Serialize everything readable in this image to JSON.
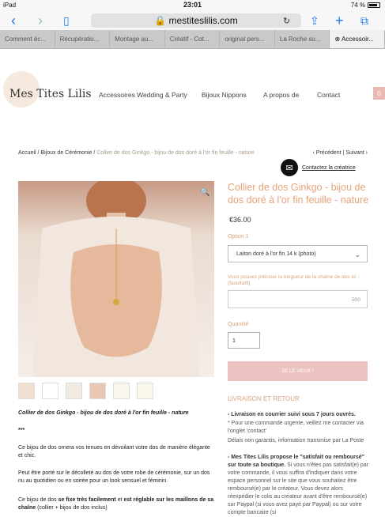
{
  "statusbar": {
    "device": "iPad",
    "time": "23:01",
    "battery": "74 %"
  },
  "browser": {
    "url": "mestiteslilis.com",
    "tabs": [
      "Comment éc...",
      "Récupératio...",
      "Montage au...",
      "Créatif - Cot...",
      "original pers...",
      "La Roche su...",
      "Accessoir..."
    ]
  },
  "site": {
    "logo": "Mes Tites Lilis",
    "nav": [
      "Accessoires Wedding & Party",
      "Bijoux Nippons",
      "A propos de",
      "Contact"
    ],
    "cart_count": "0"
  },
  "breadcrumb": {
    "home": "Accueil",
    "category": "Bijoux de Cérémonie",
    "current": "Collier de dos Ginkgo - bijou de dos doré à l'or fin feuille - nature",
    "prev": "Précédent",
    "next": "Suivant"
  },
  "contact_label": "Contactez la créatrice",
  "product": {
    "title": "Collier de dos Ginkgo - bijou de dos doré à l'or fin feuille - nature",
    "price": "€36.00",
    "option_label": "Option 1",
    "option_value": "Laiton doré à l'or fin 14 k (photo)",
    "custom_label": "Vous pouvez préciser la longueur de la chaîne de dos ici : (facultatif)",
    "custom_counter": "500",
    "qty_label": "Quantité",
    "qty_value": "1",
    "buy_label": "JE LE VEUX !"
  },
  "description": {
    "title": "Collier de dos Ginkgo - bijou de dos doré à l'or fin feuille - nature",
    "stars": "***",
    "p1": "Ce bijou de dos ornera vos tenues en dévoilant votre dos de manière élégante et chic.",
    "p2": "Peut être porté sur le décolleté au dos de votre robe de cérémonie, sur un dos nu au quotidien ou en soirée pour un look sensuel et féminin.",
    "p3a": "Ce bijou de dos ",
    "p3b": "se fixe très facilement",
    "p3c": " et ",
    "p3d": "est réglable sur les maillons de sa chaîne",
    "p3e": " (collier + bijou de dos inclus)"
  },
  "shipping": {
    "title": "LIVRAISON ET RETOUR",
    "l1": "- Livraison en courrier suivi sous 7 jours ouvrés.",
    "l2": "* Pour une commande urgente, veillez me contacter via l'onglet 'contact'",
    "l3": "Délais non garantis, information transmise par La Poste",
    "l4": "- Mes Tites Lilis propose le \"satisfait ou remboursé\" sur toute sa boutique.",
    "l5": "Si vous n'êtes pas satisfait(e) par votre commande, il vous suffira d'indiquer dans votre espace personnel sur le site que vous souhaitez être remboursé(e) par le créateur. Vous devez alors réexpédier le colis au créateur avant d'être remboursé(e) sur Paypal (si vous avez payé par Paypal) ou sur votre compte bancaire (si"
  }
}
